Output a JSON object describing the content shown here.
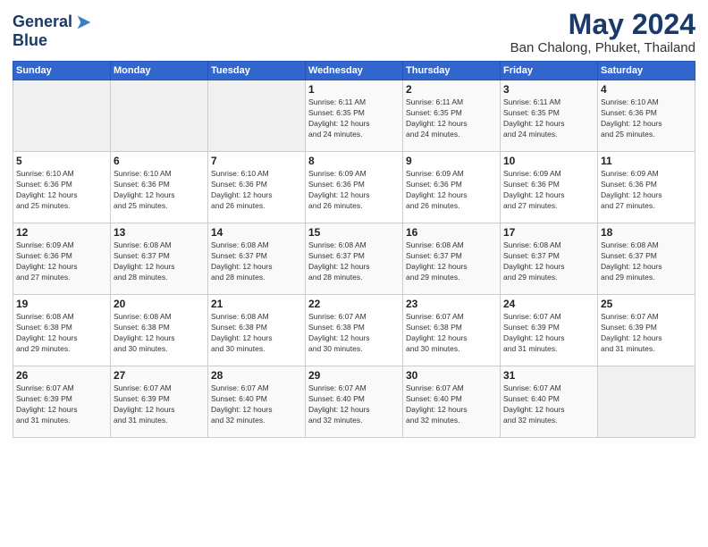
{
  "logo": {
    "line1": "General",
    "line2": "Blue"
  },
  "title": "May 2024",
  "subtitle": "Ban Chalong, Phuket, Thailand",
  "days_header": [
    "Sunday",
    "Monday",
    "Tuesday",
    "Wednesday",
    "Thursday",
    "Friday",
    "Saturday"
  ],
  "weeks": [
    [
      {
        "day": "",
        "info": ""
      },
      {
        "day": "",
        "info": ""
      },
      {
        "day": "",
        "info": ""
      },
      {
        "day": "1",
        "info": "Sunrise: 6:11 AM\nSunset: 6:35 PM\nDaylight: 12 hours\nand 24 minutes."
      },
      {
        "day": "2",
        "info": "Sunrise: 6:11 AM\nSunset: 6:35 PM\nDaylight: 12 hours\nand 24 minutes."
      },
      {
        "day": "3",
        "info": "Sunrise: 6:11 AM\nSunset: 6:35 PM\nDaylight: 12 hours\nand 24 minutes."
      },
      {
        "day": "4",
        "info": "Sunrise: 6:10 AM\nSunset: 6:36 PM\nDaylight: 12 hours\nand 25 minutes."
      }
    ],
    [
      {
        "day": "5",
        "info": "Sunrise: 6:10 AM\nSunset: 6:36 PM\nDaylight: 12 hours\nand 25 minutes."
      },
      {
        "day": "6",
        "info": "Sunrise: 6:10 AM\nSunset: 6:36 PM\nDaylight: 12 hours\nand 25 minutes."
      },
      {
        "day": "7",
        "info": "Sunrise: 6:10 AM\nSunset: 6:36 PM\nDaylight: 12 hours\nand 26 minutes."
      },
      {
        "day": "8",
        "info": "Sunrise: 6:09 AM\nSunset: 6:36 PM\nDaylight: 12 hours\nand 26 minutes."
      },
      {
        "day": "9",
        "info": "Sunrise: 6:09 AM\nSunset: 6:36 PM\nDaylight: 12 hours\nand 26 minutes."
      },
      {
        "day": "10",
        "info": "Sunrise: 6:09 AM\nSunset: 6:36 PM\nDaylight: 12 hours\nand 27 minutes."
      },
      {
        "day": "11",
        "info": "Sunrise: 6:09 AM\nSunset: 6:36 PM\nDaylight: 12 hours\nand 27 minutes."
      }
    ],
    [
      {
        "day": "12",
        "info": "Sunrise: 6:09 AM\nSunset: 6:36 PM\nDaylight: 12 hours\nand 27 minutes."
      },
      {
        "day": "13",
        "info": "Sunrise: 6:08 AM\nSunset: 6:37 PM\nDaylight: 12 hours\nand 28 minutes."
      },
      {
        "day": "14",
        "info": "Sunrise: 6:08 AM\nSunset: 6:37 PM\nDaylight: 12 hours\nand 28 minutes."
      },
      {
        "day": "15",
        "info": "Sunrise: 6:08 AM\nSunset: 6:37 PM\nDaylight: 12 hours\nand 28 minutes."
      },
      {
        "day": "16",
        "info": "Sunrise: 6:08 AM\nSunset: 6:37 PM\nDaylight: 12 hours\nand 29 minutes."
      },
      {
        "day": "17",
        "info": "Sunrise: 6:08 AM\nSunset: 6:37 PM\nDaylight: 12 hours\nand 29 minutes."
      },
      {
        "day": "18",
        "info": "Sunrise: 6:08 AM\nSunset: 6:37 PM\nDaylight: 12 hours\nand 29 minutes."
      }
    ],
    [
      {
        "day": "19",
        "info": "Sunrise: 6:08 AM\nSunset: 6:38 PM\nDaylight: 12 hours\nand 29 minutes."
      },
      {
        "day": "20",
        "info": "Sunrise: 6:08 AM\nSunset: 6:38 PM\nDaylight: 12 hours\nand 30 minutes."
      },
      {
        "day": "21",
        "info": "Sunrise: 6:08 AM\nSunset: 6:38 PM\nDaylight: 12 hours\nand 30 minutes."
      },
      {
        "day": "22",
        "info": "Sunrise: 6:07 AM\nSunset: 6:38 PM\nDaylight: 12 hours\nand 30 minutes."
      },
      {
        "day": "23",
        "info": "Sunrise: 6:07 AM\nSunset: 6:38 PM\nDaylight: 12 hours\nand 30 minutes."
      },
      {
        "day": "24",
        "info": "Sunrise: 6:07 AM\nSunset: 6:39 PM\nDaylight: 12 hours\nand 31 minutes."
      },
      {
        "day": "25",
        "info": "Sunrise: 6:07 AM\nSunset: 6:39 PM\nDaylight: 12 hours\nand 31 minutes."
      }
    ],
    [
      {
        "day": "26",
        "info": "Sunrise: 6:07 AM\nSunset: 6:39 PM\nDaylight: 12 hours\nand 31 minutes."
      },
      {
        "day": "27",
        "info": "Sunrise: 6:07 AM\nSunset: 6:39 PM\nDaylight: 12 hours\nand 31 minutes."
      },
      {
        "day": "28",
        "info": "Sunrise: 6:07 AM\nSunset: 6:40 PM\nDaylight: 12 hours\nand 32 minutes."
      },
      {
        "day": "29",
        "info": "Sunrise: 6:07 AM\nSunset: 6:40 PM\nDaylight: 12 hours\nand 32 minutes."
      },
      {
        "day": "30",
        "info": "Sunrise: 6:07 AM\nSunset: 6:40 PM\nDaylight: 12 hours\nand 32 minutes."
      },
      {
        "day": "31",
        "info": "Sunrise: 6:07 AM\nSunset: 6:40 PM\nDaylight: 12 hours\nand 32 minutes."
      },
      {
        "day": "",
        "info": ""
      }
    ]
  ]
}
